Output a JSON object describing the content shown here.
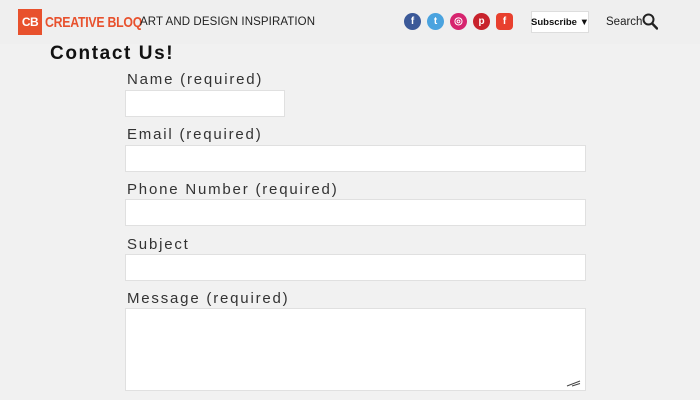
{
  "header": {
    "logo_badge": "CB",
    "logo_text": "CREATIVE BLOQ",
    "tagline": "ART AND DESIGN INSPIRATION",
    "social": {
      "facebook": "f",
      "twitter": "t",
      "instagram": "◎",
      "pinterest": "p",
      "flipboard": "f"
    },
    "subscribe_label": "Subscribe ▼",
    "search_label": "Search",
    "colors": {
      "brand": "#e8512d",
      "facebook": "#3b5998",
      "twitter": "#4aa3df",
      "instagram": "#d6246e",
      "pinterest": "#c8232c",
      "flipboard": "#e8402e"
    }
  },
  "form": {
    "title": "Contact Us!",
    "fields": [
      {
        "label": "Name (required)",
        "value": ""
      },
      {
        "label": "Email (required)",
        "value": ""
      },
      {
        "label": "Phone Number (required)",
        "value": ""
      },
      {
        "label": "Subject",
        "value": ""
      },
      {
        "label": "Message (required)",
        "value": ""
      }
    ]
  }
}
